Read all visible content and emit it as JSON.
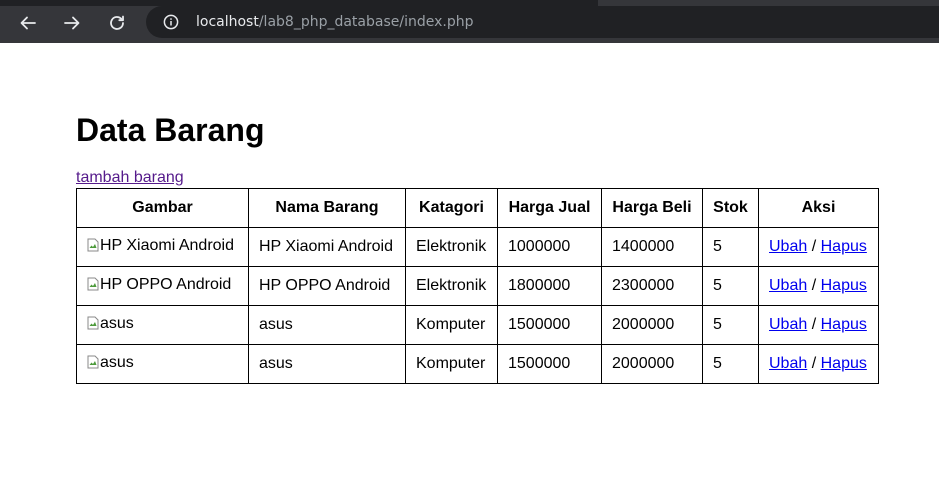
{
  "browser": {
    "url_host": "localhost",
    "url_path": "/lab8_php_database/index.php"
  },
  "page": {
    "title": "Data Barang",
    "add_link": "tambah barang"
  },
  "table": {
    "headers": {
      "gambar": "Gambar",
      "nama": "Nama Barang",
      "kategori": "Katagori",
      "harga_jual": "Harga Jual",
      "harga_beli": "Harga Beli",
      "stok": "Stok",
      "aksi": "Aksi"
    },
    "rows": [
      {
        "gambar_alt": "HP Xiaomi Android",
        "nama": "HP Xiaomi Android",
        "kategori": "Elektronik",
        "harga_jual": "1000000",
        "harga_beli": "1400000",
        "stok": "5",
        "ubah": "Ubah",
        "sep": "/",
        "hapus": "Hapus"
      },
      {
        "gambar_alt": "HP OPPO Android",
        "nama": "HP OPPO Android",
        "kategori": "Elektronik",
        "harga_jual": "1800000",
        "harga_beli": "2300000",
        "stok": "5",
        "ubah": "Ubah",
        "sep": "/",
        "hapus": "Hapus"
      },
      {
        "gambar_alt": "asus",
        "nama": "asus",
        "kategori": "Komputer",
        "harga_jual": "1500000",
        "harga_beli": "2000000",
        "stok": "5",
        "ubah": "Ubah",
        "sep": "/",
        "hapus": "Hapus"
      },
      {
        "gambar_alt": "asus",
        "nama": "asus",
        "kategori": "Komputer",
        "harga_jual": "1500000",
        "harga_beli": "2000000",
        "stok": "5",
        "ubah": "Ubah",
        "sep": "/",
        "hapus": "Hapus"
      }
    ]
  },
  "icons": {
    "back": "arrow-left-icon",
    "forward": "arrow-right-icon",
    "reload": "reload-icon",
    "info": "info-icon",
    "broken_image": "broken-image-icon"
  },
  "colors": {
    "toolbar_bg": "#35363a",
    "omnibox_bg": "#202124",
    "link_visited": "#551a8b",
    "link": "#0000ee"
  }
}
